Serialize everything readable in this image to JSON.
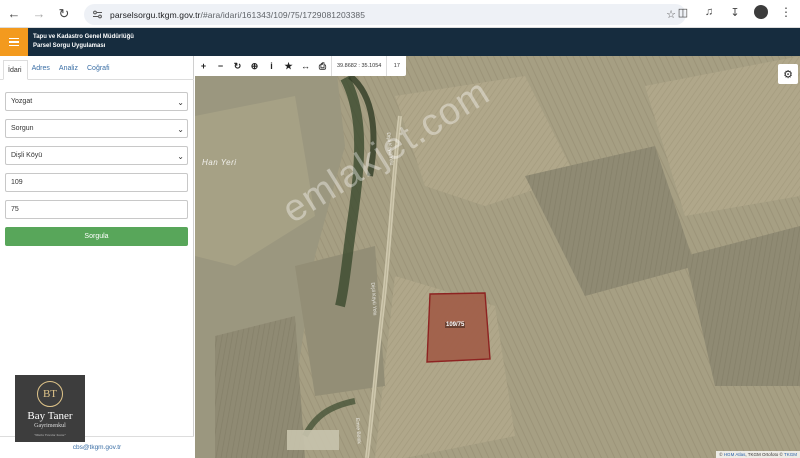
{
  "browser": {
    "url_host": "parselsorgu.tkgm.gov.tr",
    "url_path": "/#ara/idari/161343/109/75/1729081203385"
  },
  "app": {
    "title_line1": "Tapu ve Kadastro Genel Müdürlüğü",
    "title_line2": "Parsel Sorgu Uygulaması"
  },
  "tabs": [
    {
      "label": "İdari"
    },
    {
      "label": "Adres"
    },
    {
      "label": "Analiz"
    },
    {
      "label": "Coğrafi"
    }
  ],
  "form": {
    "il": "Yozgat",
    "ilce": "Sorgun",
    "mahalle": "Dişli Köyü",
    "ada": "109",
    "parsel": "75",
    "submit_label": "Sorgula"
  },
  "footer": {
    "email": "cbs@tkgm.gov.tr"
  },
  "logo": {
    "monogram": "BT",
    "name": "Bay Taner",
    "subtitle": "Gayrimenkul",
    "tagline": "\"Mutlu Yuvalar Kurar\""
  },
  "map": {
    "coordinates": "39.8682 : 35.1054",
    "zoom": "17",
    "place_label": "Han Yeri",
    "road_label_1": "Dişli Köyü Yolu",
    "road_label_2": "Dişli Köyü Yolu",
    "road_label_3": "Emre Bölük",
    "parcel_label": "109/75",
    "watermark": "emlakjet.com",
    "attribution_prefix": "©",
    "attribution_1": "HGM Atlas",
    "attribution_2": ", TKGM Ortofoto ©",
    "attribution_3": "TKGM"
  }
}
